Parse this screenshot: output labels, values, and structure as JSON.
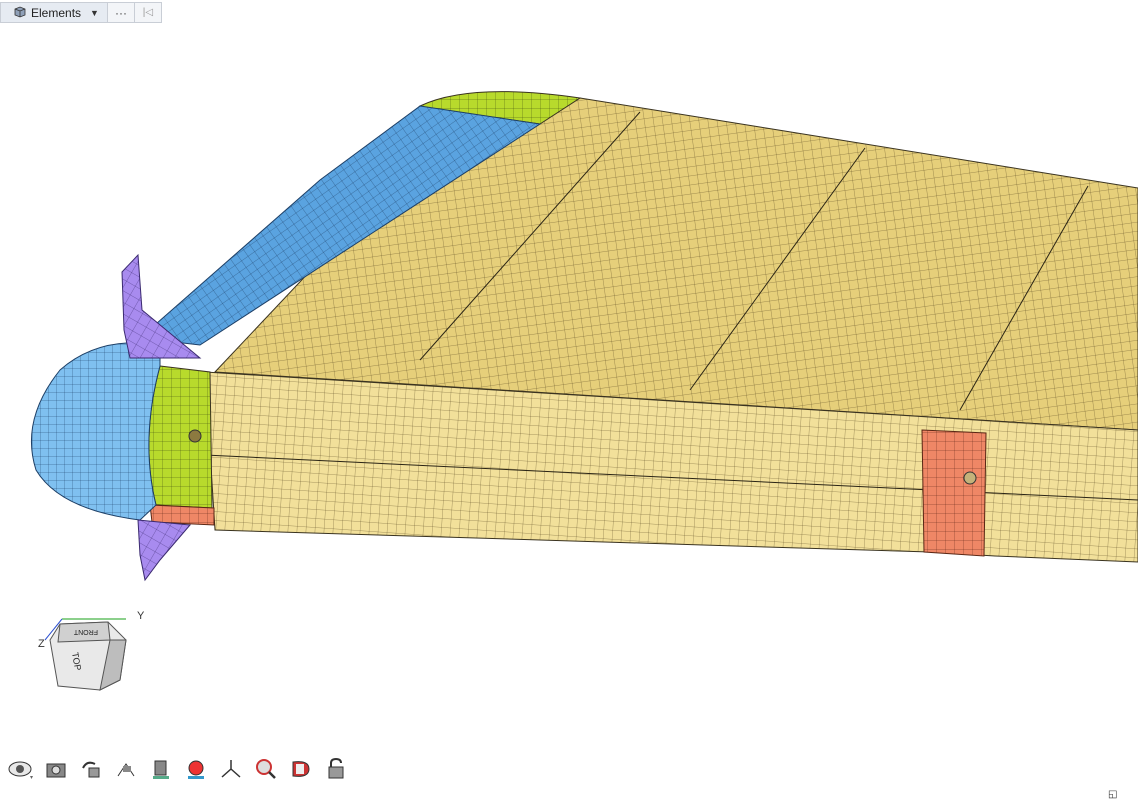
{
  "toolbar": {
    "entity_selector": {
      "label": "Elements",
      "icon": "element-cube-icon"
    },
    "more_label": "···",
    "collapse_label": "|◁"
  },
  "view_cube": {
    "face_top": "TOP",
    "face_front": "FRONT",
    "axis_y": "Y",
    "axis_z": "Z"
  },
  "colors": {
    "skin_yellow": "#e6cf7a",
    "skin_yellow_light": "#f3e29a",
    "nose_blue": "#5aa3e0",
    "collar_green": "#b8da2c",
    "patch_orange": "#ef8766",
    "fin_purple": "#a88bef",
    "mesh_line": "#3a3320"
  },
  "bottom_toolbar": [
    {
      "name": "visibility-eye-icon"
    },
    {
      "name": "camera-view-icon"
    },
    {
      "name": "rotate-view-icon"
    },
    {
      "name": "pan-view-icon"
    },
    {
      "name": "shaded-mode-icon"
    },
    {
      "name": "color-by-icon"
    },
    {
      "name": "axis-triad-icon"
    },
    {
      "name": "zoom-icon"
    },
    {
      "name": "section-cut-icon"
    },
    {
      "name": "lock-icon"
    }
  ]
}
